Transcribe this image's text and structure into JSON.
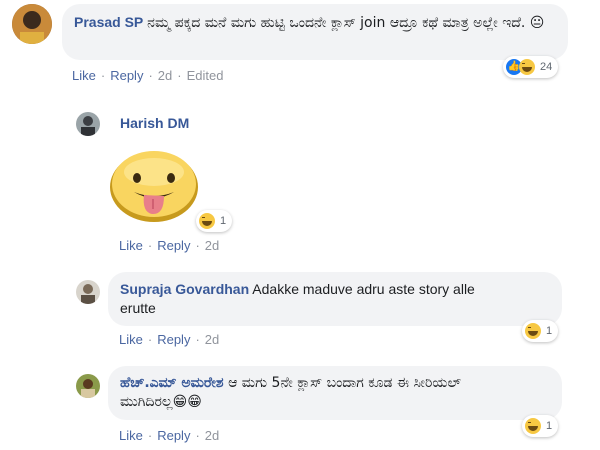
{
  "comments": [
    {
      "author": "Prasad SP",
      "text": "ನಮ್ಮ ಪಕ್ಕದ ಮನೆ ಮಗು ಹುಟ್ಟಿ ಒಂದನೇ ಕ್ಲಾಸ್ join ಆದ್ರೂ ಕಥೆ ಮಾತ್ರ ಅಲ್ಲೇ ಇದೆ. 😐",
      "actions": {
        "like": "Like",
        "reply": "Reply",
        "time": "2d",
        "edited": "Edited"
      },
      "reactions": {
        "types": [
          "like-icon",
          "haha-icon"
        ],
        "count": "24"
      }
    },
    {
      "author": "Harish DM",
      "sticker": "tongue-out-sticker",
      "actions": {
        "like": "Like",
        "reply": "Reply",
        "time": "2d"
      },
      "reactions": {
        "types": [
          "haha-icon"
        ],
        "count": "1"
      }
    },
    {
      "author": "Supraja Govardhan",
      "text_line1": "Adakke maduve adru aste story alle",
      "text_line2": "erutte",
      "actions": {
        "like": "Like",
        "reply": "Reply",
        "time": "2d"
      },
      "reactions": {
        "types": [
          "haha-icon"
        ],
        "count": "1"
      }
    },
    {
      "author": "ಹೆಚ್.ಎಮ್ ಅಮರೇಶ",
      "text_line1": "ಆ ಮಗು 5ನೇ ಕ್ಲಾಸ್ ಬಂದಾಗ ಕೂಡ ಈ ಸೀರಿಯಲ್",
      "text_line2": "ಮುಗಿದಿರಲ್ಲ😁😁",
      "actions": {
        "like": "Like",
        "reply": "Reply",
        "time": "2d"
      },
      "reactions": {
        "types": [
          "haha-icon"
        ],
        "count": "1"
      }
    }
  ],
  "colors": {
    "name": "#385898",
    "bubble": "#f2f3f5",
    "action": "#4b67a1",
    "meta": "#90949c"
  }
}
